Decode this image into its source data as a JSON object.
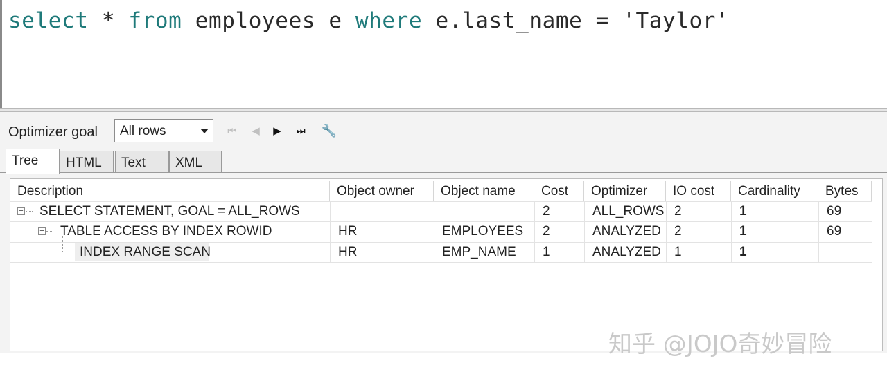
{
  "editor": {
    "sql_parts": {
      "select": "select",
      "star": "*",
      "from": "from",
      "table": "employees",
      "alias": "e",
      "where": "where",
      "column": "e.last_name",
      "eq": "=",
      "value": "'Taylor'"
    }
  },
  "toolbar": {
    "optimizer_goal_label": "Optimizer goal",
    "optimizer_goal_value": "All rows",
    "nav": {
      "first": "⏮",
      "prev": "◀",
      "next": "▶",
      "last": "⏭"
    },
    "wrench_glyph": "🔧"
  },
  "tabs": [
    {
      "label": "Tree",
      "active": true
    },
    {
      "label": "HTML",
      "active": false
    },
    {
      "label": "Text",
      "active": false
    },
    {
      "label": "XML",
      "active": false
    }
  ],
  "plan": {
    "columns": [
      "Description",
      "Object owner",
      "Object name",
      "Cost",
      "Optimizer",
      "IO cost",
      "Cardinality",
      "Bytes"
    ],
    "rows": [
      {
        "description": "SELECT STATEMENT, GOAL = ALL_ROWS",
        "owner": "",
        "name": "",
        "cost": "2",
        "optimizer": "ALL_ROWS",
        "io_cost": "2",
        "cardinality": "1",
        "bytes": "69"
      },
      {
        "description": "TABLE ACCESS BY INDEX ROWID",
        "owner": "HR",
        "name": "EMPLOYEES",
        "cost": "2",
        "optimizer": "ANALYZED",
        "io_cost": "2",
        "cardinality": "1",
        "bytes": "69"
      },
      {
        "description": "INDEX RANGE SCAN",
        "owner": "HR",
        "name": "EMP_NAME",
        "cost": "1",
        "optimizer": "ANALYZED",
        "io_cost": "1",
        "cardinality": "1",
        "bytes": ""
      }
    ]
  },
  "watermark": "知乎 @JOJO奇妙冒险",
  "colors": {
    "keyword": "#1f7a7a",
    "panel_bg": "#f3f3f3"
  }
}
